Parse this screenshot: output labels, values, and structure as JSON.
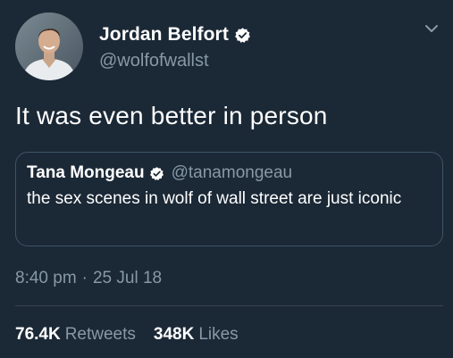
{
  "author": {
    "display_name": "Jordan Belfort",
    "handle": "@wolfofwallst",
    "verified": true
  },
  "tweet": {
    "text": "It was even better in person",
    "timestamp": "8:40 pm",
    "separator": "·",
    "date": "25 Jul 18"
  },
  "quoted_tweet": {
    "display_name": "Tana Mongeau",
    "handle": "@tanamongeau",
    "verified": true,
    "text": "the sex scenes in wolf of wall street are just iconic"
  },
  "stats": {
    "retweets_count": "76.4K",
    "retweets_label": "Retweets",
    "likes_count": "348K",
    "likes_label": "Likes"
  },
  "colors": {
    "background": "#1b2836",
    "secondary_text": "#8899a6",
    "border": "#3d5466",
    "primary_text": "#ffffff"
  },
  "icons": {
    "verified": "verified-badge-icon",
    "menu": "chevron-down-icon"
  }
}
